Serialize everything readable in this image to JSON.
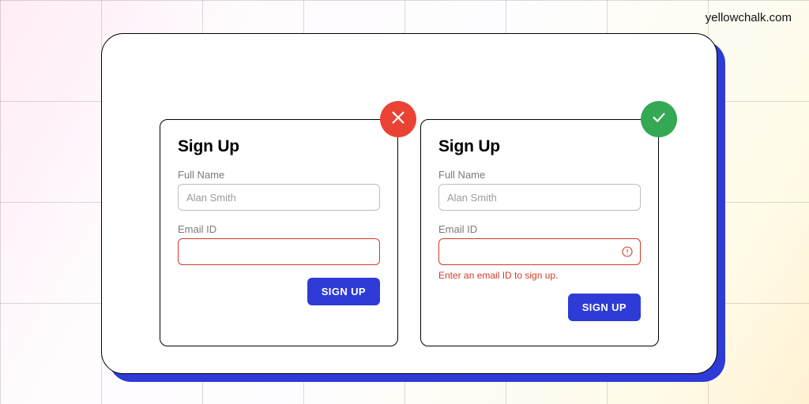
{
  "watermark": "yellowchalk.com",
  "colors": {
    "accent_blue": "#2e3bd6",
    "error_red": "#d23b2a",
    "bad_badge": "#ea4335",
    "good_badge": "#34a853"
  },
  "card_bad": {
    "title": "Sign Up",
    "full_name_label": "Full Name",
    "full_name_placeholder": "Alan Smith",
    "email_label": "Email ID",
    "email_value": "",
    "button_label": "SIGN UP"
  },
  "card_good": {
    "title": "Sign Up",
    "full_name_label": "Full Name",
    "full_name_placeholder": "Alan Smith",
    "email_label": "Email ID",
    "email_value": "",
    "email_error_msg": "Enter an email ID to sign up.",
    "button_label": "SIGN UP"
  }
}
